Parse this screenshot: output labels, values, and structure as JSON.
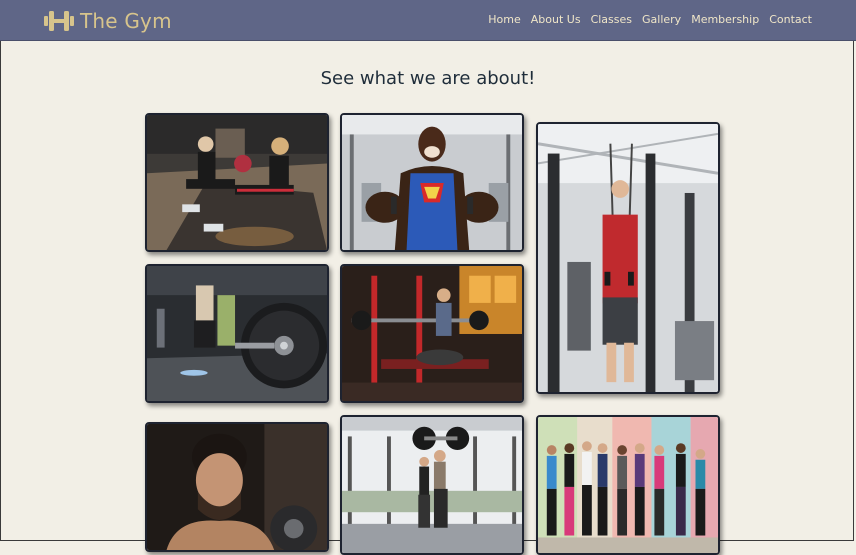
{
  "brand": {
    "name": "The Gym",
    "icon": "dumbbell-icon",
    "color": "#d7c48c"
  },
  "nav": {
    "items": [
      "Home",
      "About Us",
      "Classes",
      "Gallery",
      "Membership",
      "Contact"
    ]
  },
  "gallery": {
    "heading": "See what we are about!",
    "photos": [
      "partner-workout-photo",
      "superman-athlete-photo",
      "cable-machine-photo",
      "barbell-plate-photo",
      "bench-press-photo",
      "man-with-weights-photo",
      "couple-lifting-photo",
      "group-women-photo"
    ]
  },
  "colors": {
    "header_bg": "#5f6687",
    "page_bg": "#f2efe6",
    "nav_text": "#f0e6c8",
    "heading_text": "#1f2d3a"
  }
}
